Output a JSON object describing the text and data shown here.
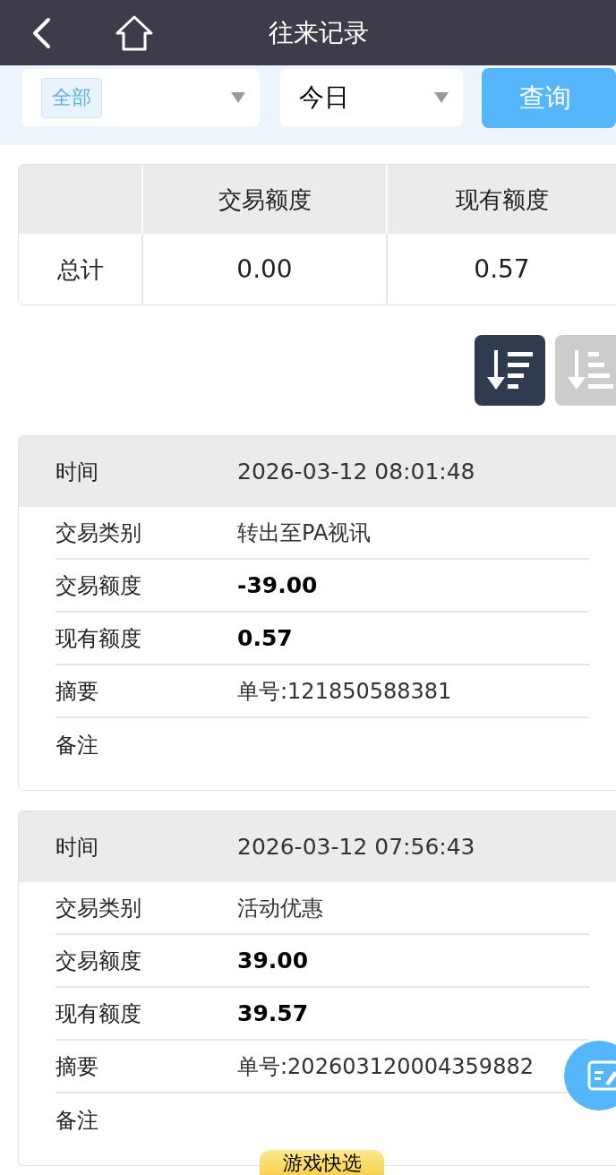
{
  "header": {
    "title": "往来记录"
  },
  "filters": {
    "category": {
      "tag": "全部"
    },
    "period": {
      "value": "今日"
    },
    "query_button": "查询"
  },
  "summary_table": {
    "columns": [
      "交易额度",
      "现有额度"
    ],
    "rows": [
      {
        "label": "总计",
        "cells": [
          "0.00",
          "0.57"
        ]
      }
    ]
  },
  "sort_options": [
    {
      "kind": "descending",
      "selected": true
    },
    {
      "kind": "ascending",
      "selected": false
    }
  ],
  "records": [
    {
      "time_label": "时间",
      "time": "2026-03-12 08:01:48",
      "fields": [
        {
          "label": "交易类别",
          "value": "转出至PA视讯",
          "kind": "text"
        },
        {
          "label": "交易额度",
          "value": "-39.00",
          "kind": "amount"
        },
        {
          "label": "现有额度",
          "value": "0.57",
          "kind": "amount"
        },
        {
          "label": "摘要",
          "value": "单号:121850588381",
          "kind": "text"
        },
        {
          "label": "备注"
        }
      ]
    },
    {
      "time_label": "时间",
      "time": "2026-03-12 07:56:43",
      "fields": [
        {
          "label": "交易类别",
          "value": "活动优惠",
          "kind": "text"
        },
        {
          "label": "交易额度",
          "value": "39.00",
          "kind": "amount"
        },
        {
          "label": "现有额度",
          "value": "39.57",
          "kind": "amount"
        },
        {
          "label": "摘要",
          "value": "单号:202603120004359882",
          "kind": "text"
        },
        {
          "label": "备注"
        }
      ]
    }
  ],
  "quick_pick_button": "游戏快选"
}
